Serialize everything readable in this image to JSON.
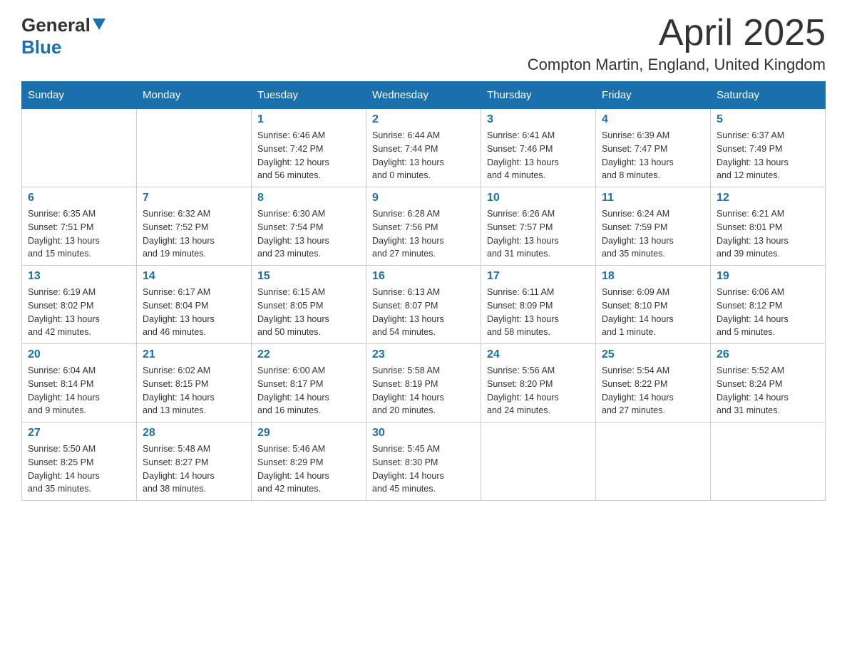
{
  "logo": {
    "general": "General",
    "blue": "Blue"
  },
  "title": "April 2025",
  "location": "Compton Martin, England, United Kingdom",
  "days_of_week": [
    "Sunday",
    "Monday",
    "Tuesday",
    "Wednesday",
    "Thursday",
    "Friday",
    "Saturday"
  ],
  "weeks": [
    [
      {
        "day": "",
        "info": ""
      },
      {
        "day": "",
        "info": ""
      },
      {
        "day": "1",
        "info": "Sunrise: 6:46 AM\nSunset: 7:42 PM\nDaylight: 12 hours\nand 56 minutes."
      },
      {
        "day": "2",
        "info": "Sunrise: 6:44 AM\nSunset: 7:44 PM\nDaylight: 13 hours\nand 0 minutes."
      },
      {
        "day": "3",
        "info": "Sunrise: 6:41 AM\nSunset: 7:46 PM\nDaylight: 13 hours\nand 4 minutes."
      },
      {
        "day": "4",
        "info": "Sunrise: 6:39 AM\nSunset: 7:47 PM\nDaylight: 13 hours\nand 8 minutes."
      },
      {
        "day": "5",
        "info": "Sunrise: 6:37 AM\nSunset: 7:49 PM\nDaylight: 13 hours\nand 12 minutes."
      }
    ],
    [
      {
        "day": "6",
        "info": "Sunrise: 6:35 AM\nSunset: 7:51 PM\nDaylight: 13 hours\nand 15 minutes."
      },
      {
        "day": "7",
        "info": "Sunrise: 6:32 AM\nSunset: 7:52 PM\nDaylight: 13 hours\nand 19 minutes."
      },
      {
        "day": "8",
        "info": "Sunrise: 6:30 AM\nSunset: 7:54 PM\nDaylight: 13 hours\nand 23 minutes."
      },
      {
        "day": "9",
        "info": "Sunrise: 6:28 AM\nSunset: 7:56 PM\nDaylight: 13 hours\nand 27 minutes."
      },
      {
        "day": "10",
        "info": "Sunrise: 6:26 AM\nSunset: 7:57 PM\nDaylight: 13 hours\nand 31 minutes."
      },
      {
        "day": "11",
        "info": "Sunrise: 6:24 AM\nSunset: 7:59 PM\nDaylight: 13 hours\nand 35 minutes."
      },
      {
        "day": "12",
        "info": "Sunrise: 6:21 AM\nSunset: 8:01 PM\nDaylight: 13 hours\nand 39 minutes."
      }
    ],
    [
      {
        "day": "13",
        "info": "Sunrise: 6:19 AM\nSunset: 8:02 PM\nDaylight: 13 hours\nand 42 minutes."
      },
      {
        "day": "14",
        "info": "Sunrise: 6:17 AM\nSunset: 8:04 PM\nDaylight: 13 hours\nand 46 minutes."
      },
      {
        "day": "15",
        "info": "Sunrise: 6:15 AM\nSunset: 8:05 PM\nDaylight: 13 hours\nand 50 minutes."
      },
      {
        "day": "16",
        "info": "Sunrise: 6:13 AM\nSunset: 8:07 PM\nDaylight: 13 hours\nand 54 minutes."
      },
      {
        "day": "17",
        "info": "Sunrise: 6:11 AM\nSunset: 8:09 PM\nDaylight: 13 hours\nand 58 minutes."
      },
      {
        "day": "18",
        "info": "Sunrise: 6:09 AM\nSunset: 8:10 PM\nDaylight: 14 hours\nand 1 minute."
      },
      {
        "day": "19",
        "info": "Sunrise: 6:06 AM\nSunset: 8:12 PM\nDaylight: 14 hours\nand 5 minutes."
      }
    ],
    [
      {
        "day": "20",
        "info": "Sunrise: 6:04 AM\nSunset: 8:14 PM\nDaylight: 14 hours\nand 9 minutes."
      },
      {
        "day": "21",
        "info": "Sunrise: 6:02 AM\nSunset: 8:15 PM\nDaylight: 14 hours\nand 13 minutes."
      },
      {
        "day": "22",
        "info": "Sunrise: 6:00 AM\nSunset: 8:17 PM\nDaylight: 14 hours\nand 16 minutes."
      },
      {
        "day": "23",
        "info": "Sunrise: 5:58 AM\nSunset: 8:19 PM\nDaylight: 14 hours\nand 20 minutes."
      },
      {
        "day": "24",
        "info": "Sunrise: 5:56 AM\nSunset: 8:20 PM\nDaylight: 14 hours\nand 24 minutes."
      },
      {
        "day": "25",
        "info": "Sunrise: 5:54 AM\nSunset: 8:22 PM\nDaylight: 14 hours\nand 27 minutes."
      },
      {
        "day": "26",
        "info": "Sunrise: 5:52 AM\nSunset: 8:24 PM\nDaylight: 14 hours\nand 31 minutes."
      }
    ],
    [
      {
        "day": "27",
        "info": "Sunrise: 5:50 AM\nSunset: 8:25 PM\nDaylight: 14 hours\nand 35 minutes."
      },
      {
        "day": "28",
        "info": "Sunrise: 5:48 AM\nSunset: 8:27 PM\nDaylight: 14 hours\nand 38 minutes."
      },
      {
        "day": "29",
        "info": "Sunrise: 5:46 AM\nSunset: 8:29 PM\nDaylight: 14 hours\nand 42 minutes."
      },
      {
        "day": "30",
        "info": "Sunrise: 5:45 AM\nSunset: 8:30 PM\nDaylight: 14 hours\nand 45 minutes."
      },
      {
        "day": "",
        "info": ""
      },
      {
        "day": "",
        "info": ""
      },
      {
        "day": "",
        "info": ""
      }
    ]
  ]
}
